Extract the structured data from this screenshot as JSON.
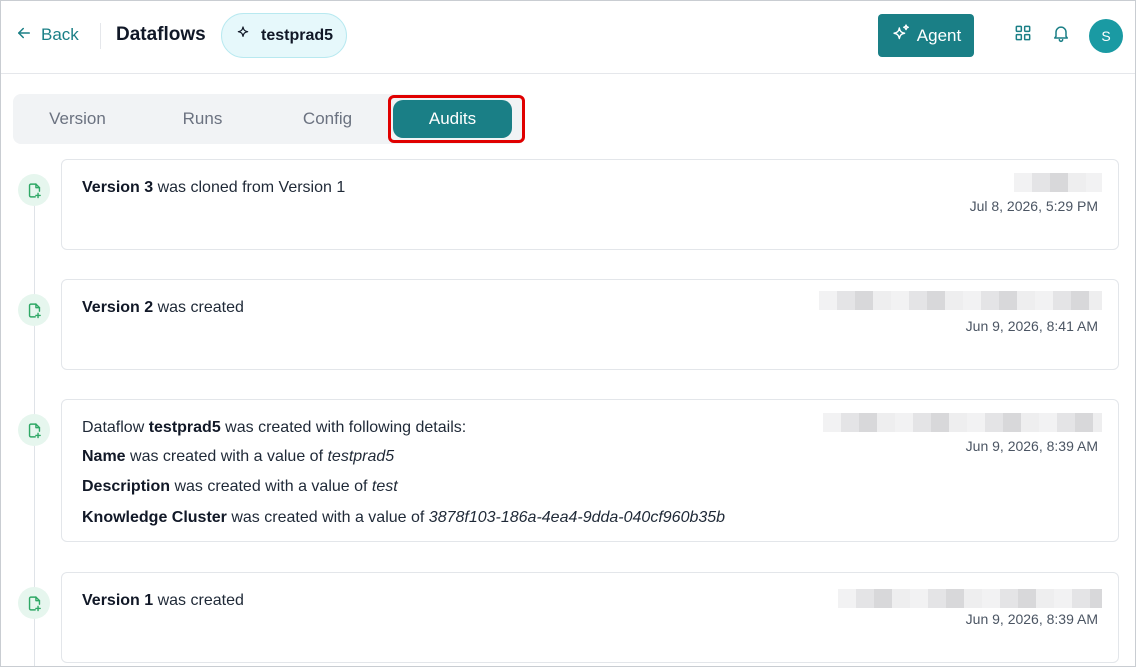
{
  "header": {
    "back_label": "Back",
    "title": "Dataflows",
    "dataflow_chip": "testprad5",
    "agent_label": "Agent",
    "avatar_initial": "S"
  },
  "tabs": [
    {
      "label": "Version",
      "active": false
    },
    {
      "label": "Runs",
      "active": false
    },
    {
      "label": "Config",
      "active": false
    },
    {
      "label": "Audits",
      "active": true
    }
  ],
  "audits": [
    {
      "parts": {
        "bold": "Version 3",
        "rest": " was cloned from Version 1"
      },
      "timestamp": "Jul 8, 2026, 5:29 PM"
    },
    {
      "parts": {
        "bold": "Version 2",
        "rest": " was created"
      },
      "timestamp": "Jun 9, 2026, 8:41 AM"
    },
    {
      "lead": {
        "pre": "Dataflow ",
        "bold": "testprad5",
        "rest": " was created with following details:"
      },
      "details": [
        {
          "field": "Name",
          "text": " was created with a value of ",
          "value": "testprad5"
        },
        {
          "field": "Description",
          "text": " was created with a value of ",
          "value": "test"
        },
        {
          "field": "Knowledge Cluster",
          "text": " was created with a value of ",
          "value": "3878f103-186a-4ea4-9dda-040cf960b35b"
        }
      ],
      "timestamp": "Jun 9, 2026, 8:39 AM"
    },
    {
      "parts": {
        "bold": "Version 1",
        "rest": " was created"
      },
      "timestamp": "Jun 9, 2026, 8:39 AM"
    }
  ],
  "colors": {
    "accent": "#1a7f86",
    "highlight": "#e00000",
    "icon_green": "#2fa866"
  },
  "icons": [
    "arrow-left-icon",
    "sparkle-icon",
    "agent-sparkles-icon",
    "grid-icon",
    "bell-icon",
    "file-plus-icon"
  ]
}
